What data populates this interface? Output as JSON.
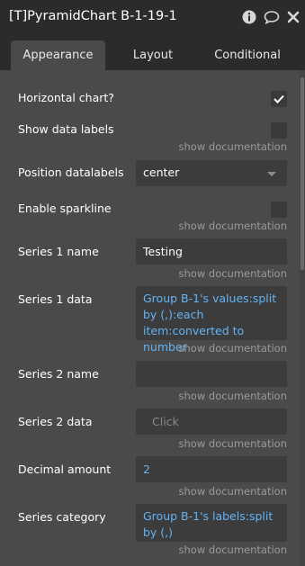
{
  "window": {
    "title": "[T]PyramidChart B-1-19-1"
  },
  "tabs": [
    {
      "label": "Appearance",
      "active": true
    },
    {
      "label": "Layout",
      "active": false
    },
    {
      "label": "Conditional",
      "active": false
    }
  ],
  "doc_link": "show documentation",
  "fields": {
    "horizontal": {
      "label": "Horizontal chart?",
      "checked": true
    },
    "data_labels": {
      "label": "Show data labels",
      "checked": false
    },
    "position_datalabels": {
      "label": "Position datalabels",
      "value": "center"
    },
    "sparkline": {
      "label": "Enable sparkline",
      "checked": false
    },
    "series1_name": {
      "label": "Series 1 name",
      "value": "Testing"
    },
    "series1_data": {
      "label": "Series 1 data",
      "value": "Group B-1's values:split by (,):each item:converted to number"
    },
    "series2_name": {
      "label": "Series 2 name",
      "value": ""
    },
    "series2_data": {
      "label": "Series 2 data",
      "placeholder": "Click"
    },
    "decimal_amount": {
      "label": "Decimal amount",
      "value": "2"
    },
    "series_category": {
      "label": "Series category",
      "value": "Group B-1's labels:split by (,)"
    }
  },
  "colors": {
    "panel": "#4a4a4a",
    "header": "#2b2b2b",
    "field": "#3c3c3c",
    "expression": "#63b3f5",
    "muted": "#9a9a9a"
  },
  "icons": [
    "info-icon",
    "comment-icon",
    "close-icon",
    "checkmark-icon",
    "chevron-down-icon"
  ]
}
